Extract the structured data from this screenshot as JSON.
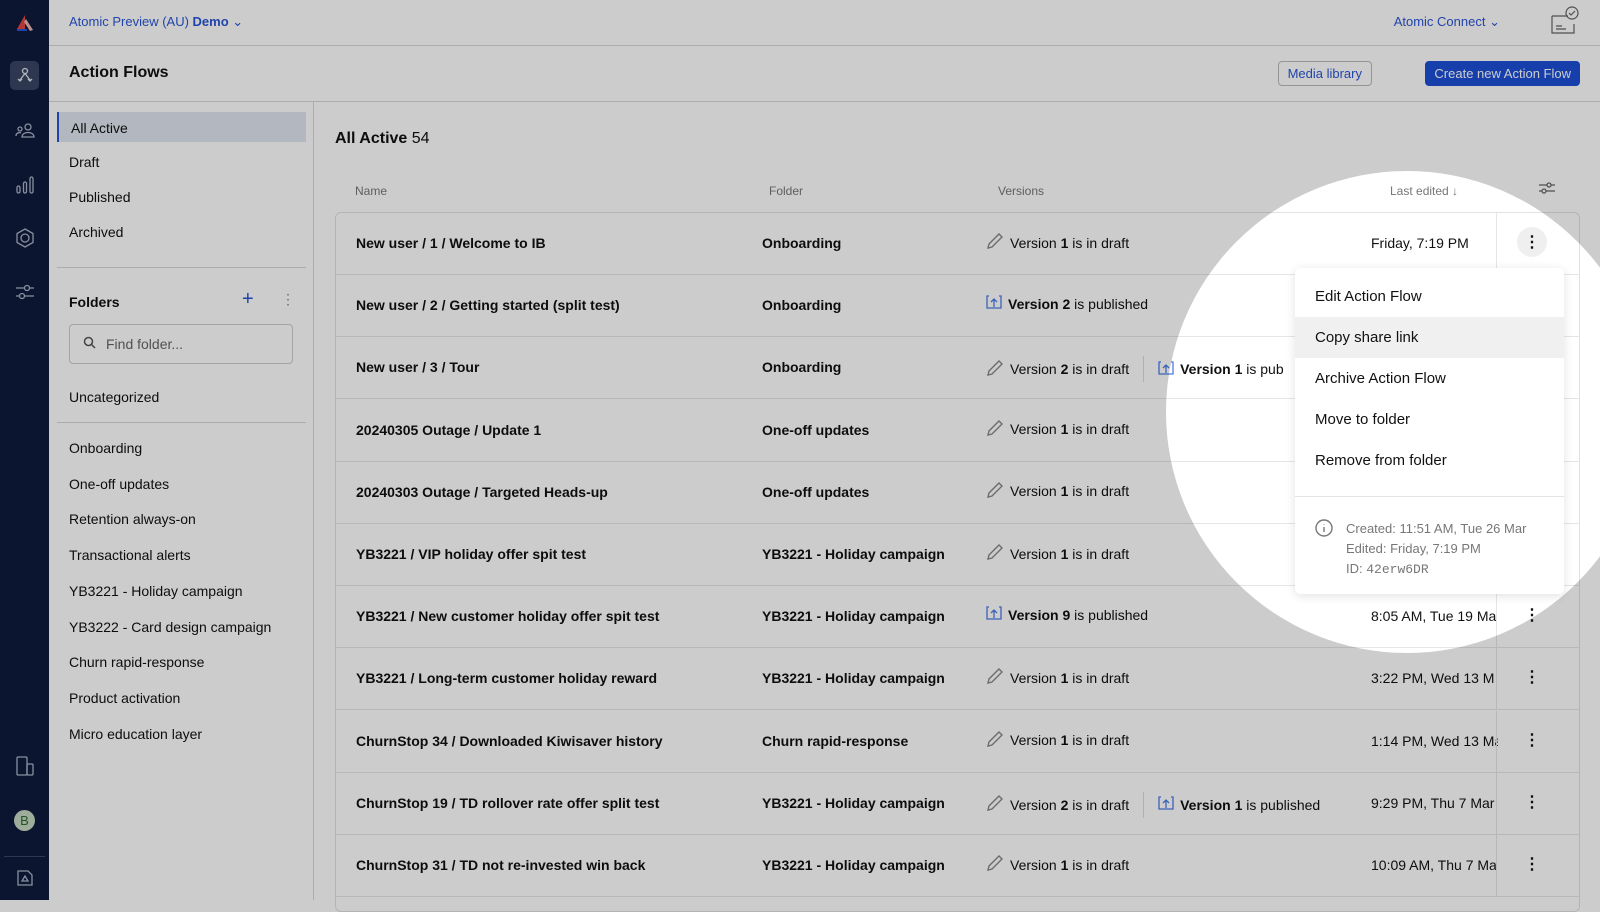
{
  "topbar": {
    "org": "Atomic Preview (AU)",
    "env": "Demo",
    "connect": "Atomic Connect"
  },
  "header": {
    "title": "Action Flows",
    "media_library": "Media library",
    "create": "Create new Action Flow"
  },
  "filters": [
    "All Active",
    "Draft",
    "Published",
    "Archived"
  ],
  "folders": {
    "title": "Folders",
    "search_placeholder": "Find folder...",
    "uncategorized": "Uncategorized",
    "items": [
      "Onboarding",
      "One-off updates",
      "Retention always-on",
      "Transactional alerts",
      "YB3221 - Holiday campaign",
      "YB3222 - Card design campaign",
      "Churn rapid-response",
      "Product activation",
      "Micro education layer"
    ]
  },
  "avatar": "B",
  "list": {
    "title": "All Active",
    "count": "54",
    "columns": {
      "name": "Name",
      "folder": "Folder",
      "versions": "Versions",
      "last_edited": "Last edited ↓"
    },
    "rows": [
      {
        "name": "New user / 1 / Welcome to IB",
        "folder": "Onboarding",
        "v": [
          {
            "type": "draft",
            "pre": "Version ",
            "num": "1",
            "post": " is in draft"
          }
        ],
        "date": "Friday, 7:19 PM"
      },
      {
        "name": "New user / 2 / Getting started (split test)",
        "folder": "Onboarding",
        "v": [
          {
            "type": "published",
            "pre": "Version ",
            "num": "2",
            "post": " is published"
          }
        ],
        "date": ""
      },
      {
        "name": "New user / 3 / Tour",
        "folder": "Onboarding",
        "v": [
          {
            "type": "draft",
            "pre": "Version ",
            "num": "2",
            "post": " is in draft"
          },
          {
            "type": "published",
            "pre": "Version ",
            "num": "1",
            "post": " is pub"
          }
        ],
        "date": ""
      },
      {
        "name": "20240305 Outage / Update 1",
        "folder": "One-off updates",
        "v": [
          {
            "type": "draft",
            "pre": "Version ",
            "num": "1",
            "post": " is in draft"
          }
        ],
        "date": ""
      },
      {
        "name": "20240303 Outage / Targeted Heads-up",
        "folder": "One-off updates",
        "v": [
          {
            "type": "draft",
            "pre": "Version ",
            "num": "1",
            "post": " is in draft"
          }
        ],
        "date": ""
      },
      {
        "name": "YB3221 / VIP holiday offer spit test",
        "folder": "YB3221 - Holiday campaign",
        "v": [
          {
            "type": "draft",
            "pre": "Version ",
            "num": "1",
            "post": " is in draft"
          }
        ],
        "date": ""
      },
      {
        "name": "YB3221 / New customer holiday offer spit test",
        "folder": "YB3221 - Holiday campaign",
        "v": [
          {
            "type": "published",
            "pre": "Version ",
            "num": "9",
            "post": " is published"
          }
        ],
        "date": "8:05 AM, Tue 19 Ma"
      },
      {
        "name": "YB3221 / Long-term customer holiday reward",
        "folder": "YB3221 - Holiday campaign",
        "v": [
          {
            "type": "draft",
            "pre": "Version ",
            "num": "1",
            "post": " is in draft"
          }
        ],
        "date": "3:22 PM, Wed 13 M"
      },
      {
        "name": "ChurnStop 34 / Downloaded Kiwisaver history",
        "folder": "Churn rapid-response",
        "v": [
          {
            "type": "draft",
            "pre": "Version ",
            "num": "1",
            "post": " is in draft"
          }
        ],
        "date": "1:14 PM, Wed 13 Ma"
      },
      {
        "name": "ChurnStop 19 / TD rollover rate offer split test",
        "folder": "YB3221 - Holiday campaign",
        "v": [
          {
            "type": "draft",
            "pre": "Version ",
            "num": "2",
            "post": " is in draft"
          },
          {
            "type": "published",
            "pre": "Version ",
            "num": "1",
            "post": " is published"
          }
        ],
        "date": "9:29 PM, Thu 7 Mar"
      },
      {
        "name": "ChurnStop 31 / TD not re-invested win back",
        "folder": "YB3221 - Holiday campaign",
        "v": [
          {
            "type": "draft",
            "pre": "Version ",
            "num": "1",
            "post": " is in draft"
          }
        ],
        "date": "10:09 AM, Thu 7 Ma"
      }
    ]
  },
  "menu": {
    "items": [
      "Edit Action Flow",
      "Copy share link",
      "Archive Action Flow",
      "Move to folder",
      "Remove from folder"
    ],
    "hovered": "Copy share link",
    "created": "Created: 11:51 AM, Tue 26 Mar",
    "edited": "Edited: Friday, 7:19 PM",
    "id_label": "ID: ",
    "id": "42erw6DR"
  },
  "colors": {
    "accent": "#1d4fd8",
    "rail": "#0f1b3d"
  }
}
